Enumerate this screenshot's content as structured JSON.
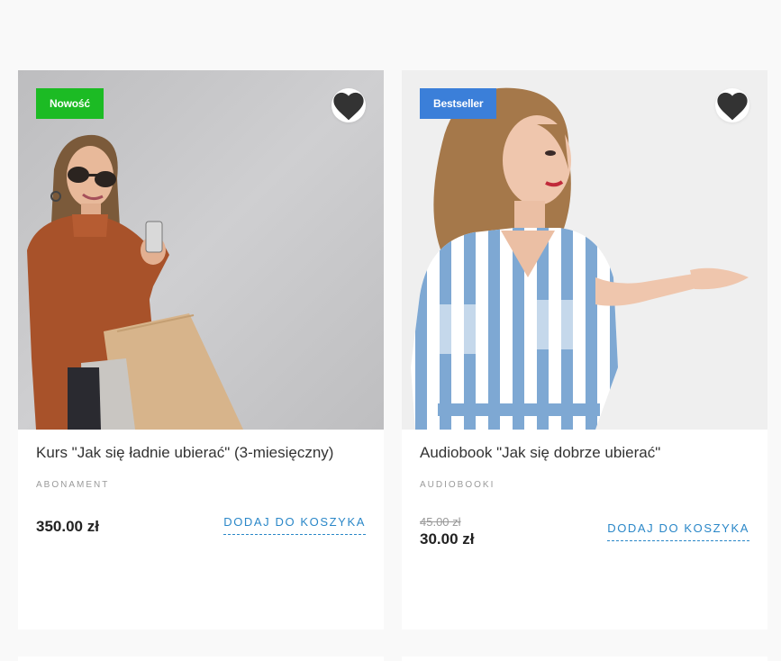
{
  "products": [
    {
      "badge": "Nowość",
      "badge_color": "#1cbb24",
      "title": "Kurs \"Jak się ładnie ubierać\" (3-miesięczny)",
      "category": "ABONAMENT",
      "price": "350.00 zł",
      "add_to_cart": "DODAJ DO KOSZYKA",
      "favorite_icon": "heart-icon"
    },
    {
      "badge": "Bestseller",
      "badge_color": "#3b7fd9",
      "title": "Audiobook \"Jak się dobrze ubierać\"",
      "category": "AUDIOBOOKI",
      "old_price": "45.00 zł",
      "price": "30.00 zł",
      "add_to_cart": "DODAJ DO KOSZYKA",
      "favorite_icon": "heart-icon"
    }
  ]
}
